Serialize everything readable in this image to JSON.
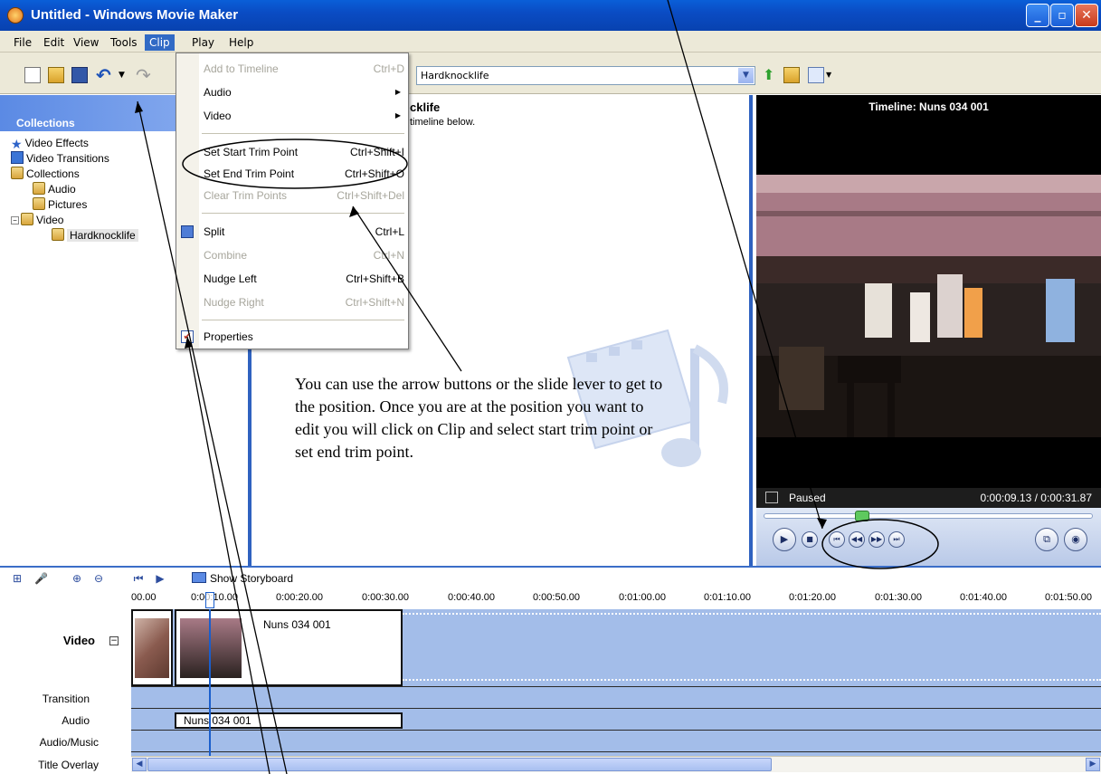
{
  "window": {
    "title": "Untitled - Windows Movie Maker",
    "controls": {
      "minimize": "_",
      "maximize": "▫",
      "close": "✕"
    }
  },
  "menubar": {
    "items": [
      "File",
      "Edit",
      "View",
      "Tools",
      "Clip",
      "Play",
      "Help"
    ],
    "active": "Clip"
  },
  "toolbar": {
    "collection_select_value": "Hardknocklife",
    "icons": [
      "new-project-icon",
      "open-project-icon",
      "save-project-icon",
      "undo-icon",
      "redo-icon",
      "up-one-level-icon",
      "new-collection-folder-icon",
      "views-icon"
    ]
  },
  "collections_pane": {
    "header": "Collections",
    "tree": [
      {
        "label": "Video Effects",
        "icon": "star-icon"
      },
      {
        "label": "Video Transitions",
        "icon": "transition-icon"
      },
      {
        "label": "Collections",
        "icon": "folder-icon"
      },
      {
        "label": "Audio",
        "icon": "folder-icon"
      },
      {
        "label": "Pictures",
        "icon": "folder-icon"
      },
      {
        "label": "Video",
        "icon": "folder-icon"
      },
      {
        "label": "Hardknocklife",
        "icon": "folder-icon"
      }
    ]
  },
  "contents_pane": {
    "title": "cklife",
    "subtitle": "timeline below."
  },
  "clip_menu": {
    "items": [
      {
        "label": "Add to Timeline",
        "shortcut": "Ctrl+D",
        "disabled": true
      },
      {
        "label": "Audio",
        "submenu": true
      },
      {
        "label": "Video",
        "submenu": true
      },
      {
        "label": "Set Start Trim Point",
        "shortcut": "Ctrl+Shift+I"
      },
      {
        "label": "Set End Trim Point",
        "shortcut": "Ctrl+Shift+O"
      },
      {
        "label": "Clear Trim Points",
        "shortcut": "Ctrl+Shift+Del",
        "disabled": true
      },
      {
        "label": "Split",
        "shortcut": "Ctrl+L",
        "icon": "split-icon"
      },
      {
        "label": "Combine",
        "shortcut": "Ctrl+N",
        "disabled": true
      },
      {
        "label": "Nudge Left",
        "shortcut": "Ctrl+Shift+B"
      },
      {
        "label": "Nudge Right",
        "shortcut": "Ctrl+Shift+N",
        "disabled": true
      },
      {
        "label": "Properties",
        "icon": "properties-icon"
      }
    ]
  },
  "monitor": {
    "title": "Timeline: Nuns 034 001",
    "status": "Paused",
    "time": "0:00:09.13 / 0:00:31.87",
    "position_fraction": 0.29
  },
  "timeline": {
    "show_storyboard_label": "Show Storyboard",
    "ruler": [
      "00.00",
      "0:00:10.00",
      "0:00:20.00",
      "0:00:30.00",
      "0:00:40.00",
      "0:00:50.00",
      "0:01:00.00",
      "0:01:10.00",
      "0:01:20.00",
      "0:01:30.00",
      "0:01:40.00",
      "0:01:50.00"
    ],
    "tracks": {
      "video": "Video",
      "transition": "Transition",
      "audio": "Audio",
      "audio_music": "Audio/Music",
      "title_overlay": "Title Overlay"
    },
    "video_clip_name": "Nuns 034 001",
    "audio_clip_name": "Nuns 034 001"
  },
  "annotation": {
    "text": "You can use the arrow buttons or the slide lever to get to the position.  Once you are at the position you want to edit you will click on Clip and select start trim point or set end trim point."
  }
}
